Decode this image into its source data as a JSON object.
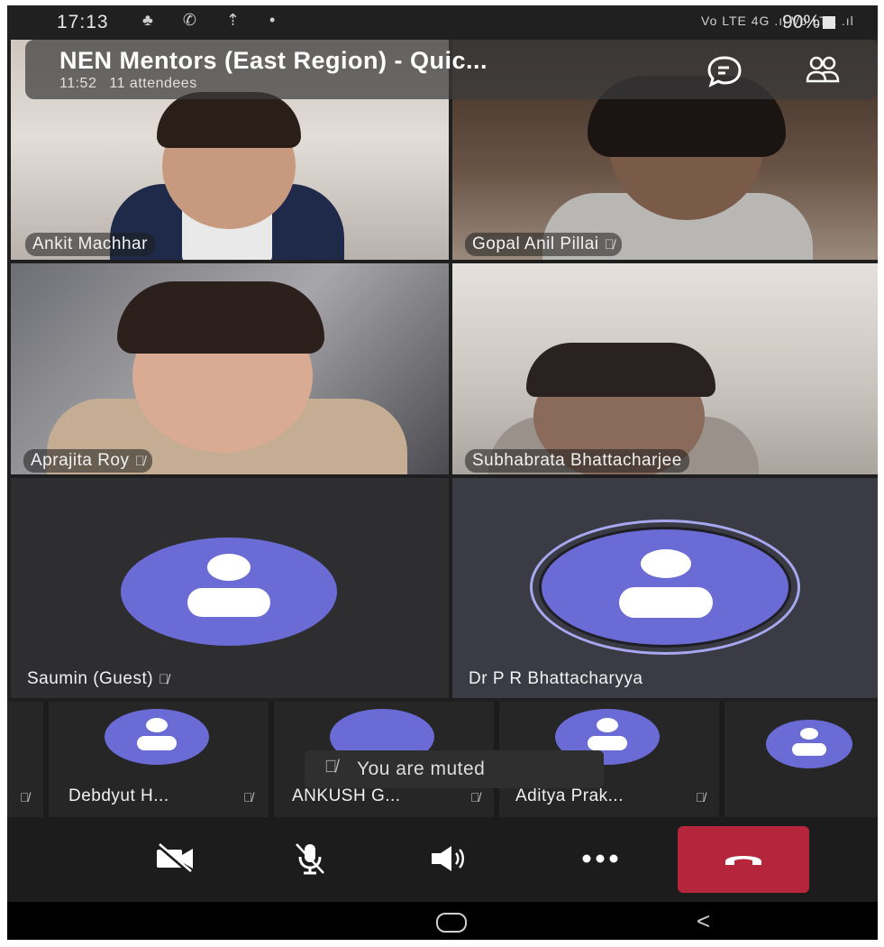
{
  "status_bar": {
    "time": "17:13",
    "icons": "♣ ✆ ⇡ •",
    "network": "Vo LTE 4G .ıl Vo LTE .ıl",
    "battery": "90%"
  },
  "meeting": {
    "title": "NEN Mentors (East Region) - Quic...",
    "duration": "11:52",
    "attendees": "11 attendees",
    "chat_icon": "chat-icon",
    "participants_icon": "people-icon"
  },
  "tiles": [
    {
      "name": "Ankit Machhar",
      "muted": false
    },
    {
      "name": "Gopal Anil Pillai",
      "muted": true
    },
    {
      "name": "Aprajita Roy",
      "muted": true
    },
    {
      "name": "Subhabrata Bhattacharjee",
      "muted": false
    },
    {
      "name": "Saumin (Guest)",
      "muted": true
    },
    {
      "name": "Dr P R Bhattacharyya",
      "muted": false
    }
  ],
  "strip": [
    {
      "name": "Debdyut H...",
      "muted": true
    },
    {
      "name": "ANKUSH G...",
      "muted": true
    },
    {
      "name": "Aditya Prak...",
      "muted": true
    }
  ],
  "toast": {
    "text": "You are muted"
  },
  "controls": {
    "camera": "camera-off-icon",
    "mic": "mic-off-icon",
    "speaker": "speaker-icon",
    "more": "more-icon",
    "hangup": "hangup-icon",
    "hangup_color": "#b5253b"
  },
  "colors": {
    "avatar": "#6b6bd6",
    "active_ring": "#a8a8f0"
  }
}
